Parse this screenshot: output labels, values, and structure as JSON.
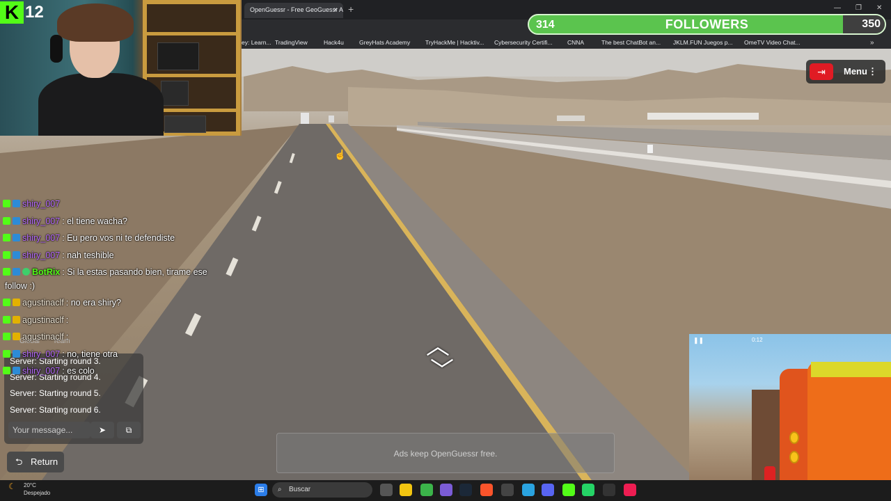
{
  "browser": {
    "tab_title": "OpenGuessr - Free GeoGuessr A",
    "tab_close": "×",
    "new_tab": "+",
    "bookmarks": [
      {
        "label": "ey: Learn...",
        "color": "#888"
      },
      {
        "label": "TradingView",
        "color": "#ddd"
      },
      {
        "label": "Hack4u",
        "color": "#e03a3a"
      },
      {
        "label": "GreyHats Academy",
        "color": "#aaa"
      },
      {
        "label": "TryHackMe | Hacktiv...",
        "color": "#d33"
      },
      {
        "label": "Cybersecurity Certifi...",
        "color": "#7cc242"
      },
      {
        "label": "CNNA",
        "color": "#888"
      },
      {
        "label": "The best ChatBot an...",
        "color": "#eee"
      },
      {
        "label": "JKLM.FUN Juegos p...",
        "color": "#8b5cf6"
      },
      {
        "label": "OmeTV Video Chat...",
        "color": "#e44"
      }
    ],
    "bookmarks_more": "»"
  },
  "stream": {
    "kick_logo": "K",
    "viewer_count": "12",
    "followers": {
      "current": "314",
      "label": "FOLLOWERS",
      "goal": "350"
    }
  },
  "game": {
    "menu_label": "Menu",
    "menu_dots": "⋮",
    "exit_icon": "⇥",
    "arrow_up": "︿",
    "arrow_down": "﹀",
    "ad_text": "Ads keep OpenGuessr free.",
    "server_tabs": {
      "global": "Global",
      "team": "Team"
    },
    "server_messages": [
      "Server: Starting round 3.",
      "Server: Starting round 4.",
      "Server: Starting round 5.",
      "Server: Starting round 6."
    ],
    "message_placeholder": "Your message...",
    "send_icon": "➤",
    "extra_icon": "⧉",
    "return_label": "Return",
    "return_icon": "⮌"
  },
  "chat": [
    {
      "user": "shiry_007",
      "color": "purple",
      "text": "",
      "badges": [
        "k",
        "p"
      ]
    },
    {
      "user": "shiry_007",
      "color": "purple",
      "text": ": el tiene wacha?",
      "badges": [
        "k",
        "p"
      ]
    },
    {
      "user": "shiry_007",
      "color": "purple",
      "text": ": Eu pero vos ni te defendiste",
      "badges": [
        "k",
        "p"
      ]
    },
    {
      "user": "shiry_007",
      "color": "purple",
      "text": ": nah teshible",
      "badges": [
        "k",
        "p"
      ]
    },
    {
      "user": "BotRix",
      "color": "green",
      "text": ": Si la estas pasando bien, tirame ese",
      "badges": [
        "k",
        "p",
        "g"
      ]
    },
    {
      "user": "",
      "color": "white",
      "text": "follow :)",
      "badges": []
    },
    {
      "user": "agustinaclf",
      "color": "white",
      "text": ": no era shiry?",
      "badges": [
        "k",
        "s"
      ]
    },
    {
      "user": "agustinaclf",
      "color": "white",
      "text": ":",
      "badges": [
        "k",
        "s"
      ]
    },
    {
      "user": "agustinaclf",
      "color": "white",
      "text": ":",
      "badges": [
        "k",
        "s"
      ]
    },
    {
      "user": "shiry_007",
      "color": "purple",
      "text": ": no, tiene otra",
      "badges": [
        "k",
        "p"
      ]
    },
    {
      "user": "shiry_007",
      "color": "purple",
      "text": ": es colo",
      "badges": [
        "k",
        "p"
      ]
    }
  ],
  "taskbar": {
    "weather_temp": "20°C",
    "weather_desc": "Despejado",
    "search_label": "Buscar"
  }
}
